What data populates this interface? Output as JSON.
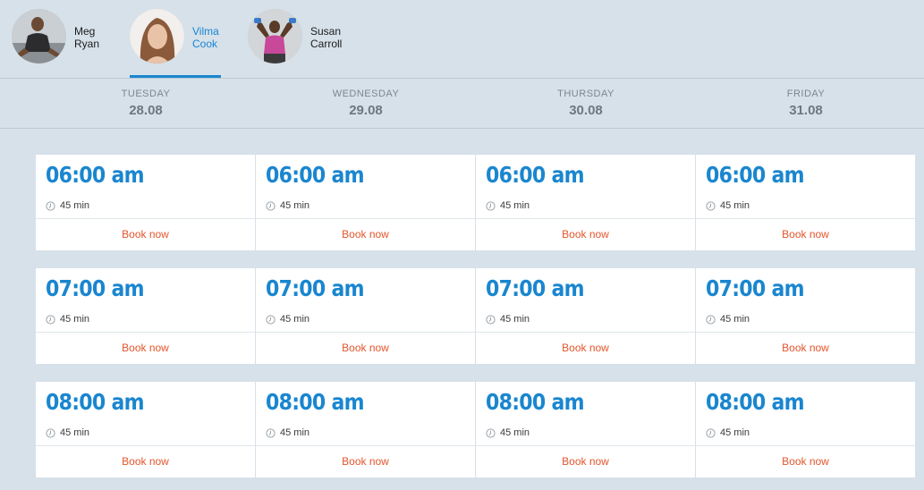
{
  "trainers": [
    {
      "first": "Meg",
      "last": "Ryan",
      "active": false,
      "avatar": "trainer-meg-photo"
    },
    {
      "first": "Vilma",
      "last": "Cook",
      "active": true,
      "avatar": "trainer-vilma-photo"
    },
    {
      "first": "Susan",
      "last": "Carroll",
      "active": false,
      "avatar": "trainer-susan-photo"
    }
  ],
  "days": [
    {
      "name": "TUESDAY",
      "date": "28.08"
    },
    {
      "name": "WEDNESDAY",
      "date": "29.08"
    },
    {
      "name": "THURSDAY",
      "date": "30.08"
    },
    {
      "name": "FRIDAY",
      "date": "31.08"
    }
  ],
  "slot_rows": [
    {
      "time": "06:00 am",
      "duration": "45 min",
      "book_label": "Book now"
    },
    {
      "time": "07:00 am",
      "duration": "45 min",
      "book_label": "Book now"
    },
    {
      "time": "08:00 am",
      "duration": "45 min",
      "book_label": "Book now"
    }
  ],
  "colors": {
    "accent": "#1a86cf",
    "book": "#e4552b",
    "background": "#d6e1ea"
  },
  "icons": {
    "duration": "clock-icon"
  }
}
